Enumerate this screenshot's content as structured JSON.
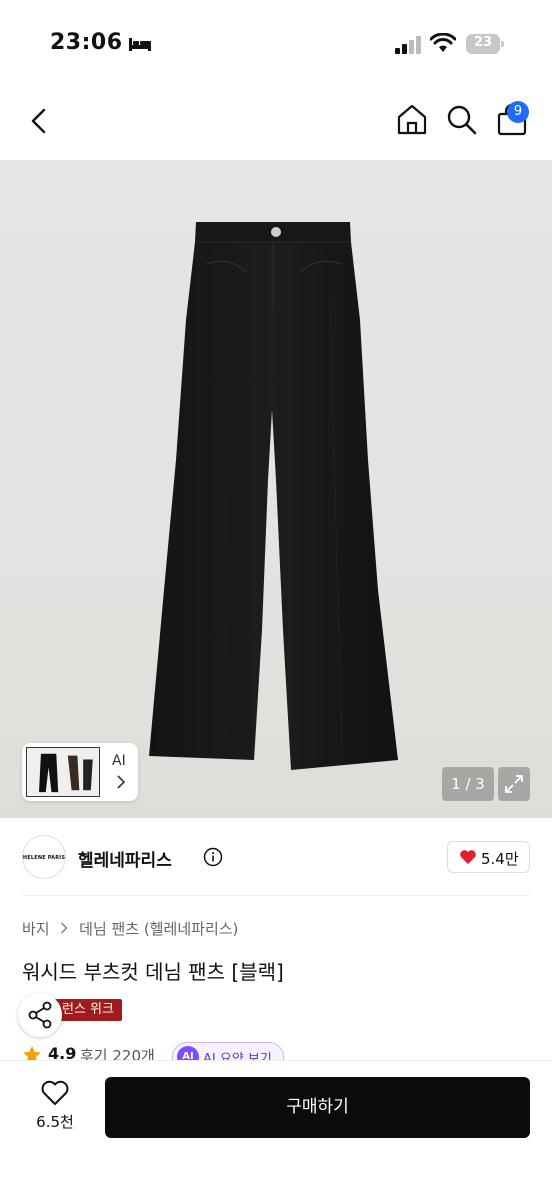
{
  "status_bar": {
    "time": "23:06",
    "battery": "23"
  },
  "nav": {
    "cart_count": "9"
  },
  "gallery": {
    "page_indicator": "1 / 3",
    "thumb_label": "AI"
  },
  "brand": {
    "logo_text": "HELENE PARIS",
    "name": "헬레네파리스",
    "likes": "5.4만"
  },
  "product": {
    "breadcrumb": [
      "바지",
      "데님 팬츠 (헬레네파리스)"
    ],
    "title": "워시드 부츠컷 데님 팬츠 [블랙]",
    "promo_badge": "런스 위크",
    "rating": "4.9",
    "review_count": "후기 220개",
    "ai_summary_icon": "AI",
    "ai_summary_label": "AI 요약 보기"
  },
  "bottom_bar": {
    "wish_count": "6.5천",
    "buy_label": "구매하기"
  },
  "colors": {
    "accent": "#1f6bff",
    "buy_button": "#0b0b0b",
    "promo": "#a01c1c",
    "heart": "#e0202a"
  },
  "icons": [
    "bed-icon",
    "signal-icon",
    "wifi-icon",
    "back-arrow-icon",
    "home-icon",
    "search-icon",
    "cart-icon",
    "chevron-right-icon",
    "expand-icon",
    "info-icon",
    "heart-icon",
    "share-icon",
    "star-icon"
  ]
}
